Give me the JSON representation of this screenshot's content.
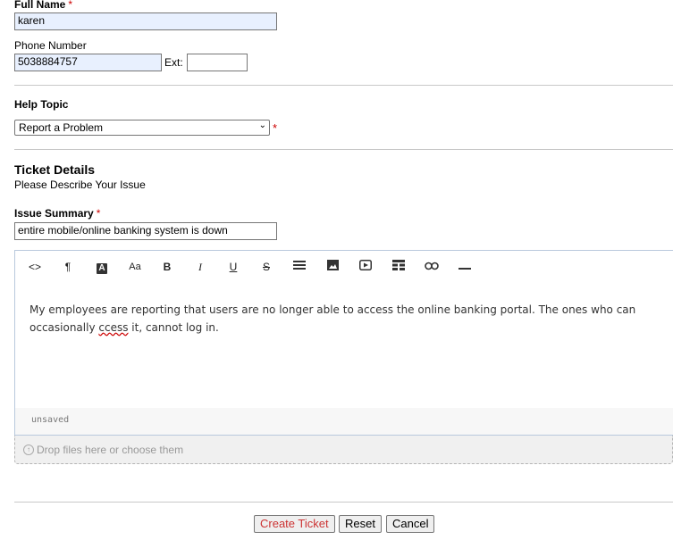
{
  "contact": {
    "full_name_label": "Full Name",
    "required_mark": "*",
    "full_name_value": "karen",
    "phone_label": "Phone Number",
    "phone_value": "5038884757",
    "ext_label": "Ext:",
    "ext_value": ""
  },
  "help_topic": {
    "label": "Help Topic",
    "selected": "Report a Problem"
  },
  "ticket_details": {
    "heading": "Ticket Details",
    "subheading": "Please Describe Your Issue",
    "issue_summary_label": "Issue Summary",
    "issue_summary_value": "entire mobile/online banking system is down"
  },
  "editor": {
    "toolbar_icons": [
      "code-icon",
      "paragraph-icon",
      "text-color-icon",
      "font-size-icon",
      "bold-icon",
      "italic-icon",
      "underline-icon",
      "strikethrough-icon",
      "list-icon",
      "image-icon",
      "video-icon",
      "table-icon",
      "link-icon",
      "horizontal-rule-icon"
    ],
    "body_line1": "My employees are reporting that users are no longer able to access the online banking portal. The ones who can",
    "body_line2_a": "occasionally ",
    "body_line2_b": "ccess",
    "body_line2_c": " it, cannot log in.",
    "status": "unsaved"
  },
  "attachments": {
    "drop_text": "Drop files here or choose them"
  },
  "actions": {
    "create_label": "Create Ticket",
    "reset_label": "Reset",
    "cancel_label": "Cancel"
  },
  "colors": {
    "required": "#cc0000",
    "autofill_background": "#e8f0fe"
  }
}
